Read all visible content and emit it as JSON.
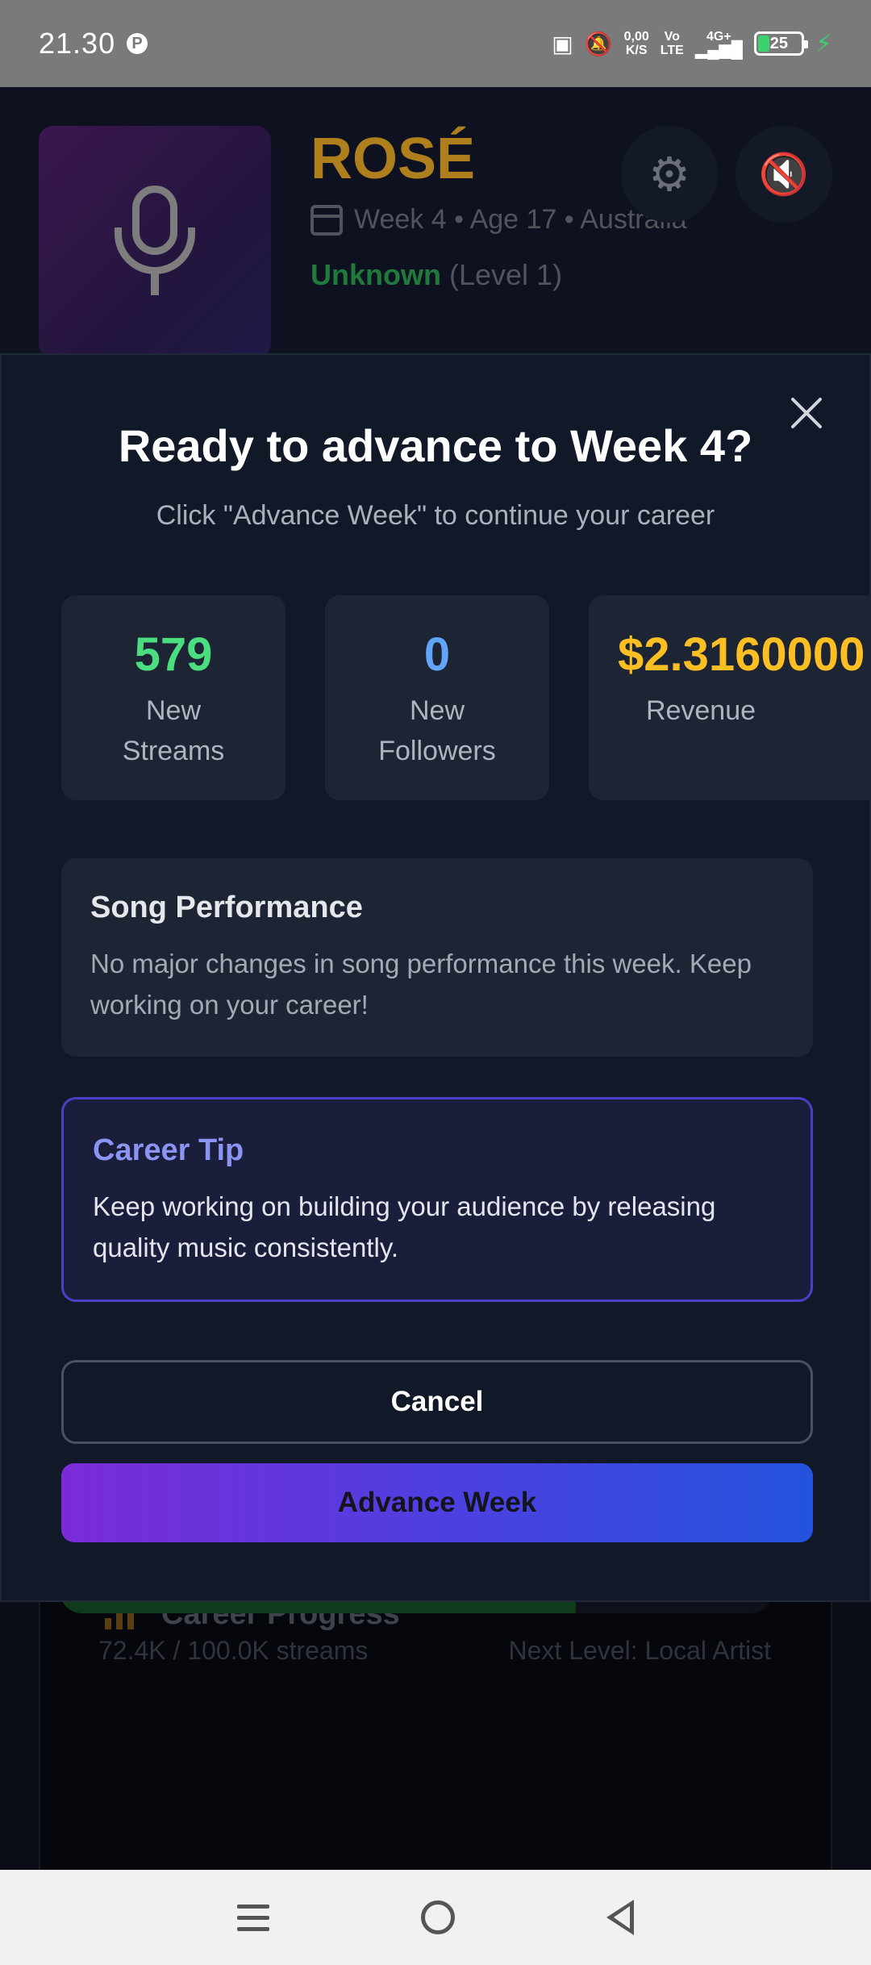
{
  "status_bar": {
    "time": "21.30",
    "p_badge": "P",
    "net_rate_top": "0,00",
    "net_rate_bottom": "K/S",
    "volte_top": "Vo",
    "volte_bottom": "LTE",
    "network": "4G+",
    "battery": "25"
  },
  "app": {
    "artist_name": "ROSÉ",
    "artist_meta": "Week 4 • Age 17 • Australia",
    "status_label": "Unknown",
    "status_level": "(Level 1)",
    "settings_icon": "gear-icon",
    "mute_icon": "mute-speaker-icon",
    "career_progress": {
      "title": "Career Progress",
      "progress": 0.724,
      "left_text": "72.4K / 100.0K streams",
      "right_text": "Next Level: Local Artist"
    }
  },
  "modal": {
    "title": "Ready to advance to Week 4?",
    "subtitle": "Click \"Advance Week\" to continue your career",
    "stats": [
      {
        "value": "579",
        "label": "New Streams",
        "color": "#4ade80"
      },
      {
        "value": "0",
        "label": "New Followers",
        "color": "#60a5fa"
      },
      {
        "value": "$2.3160000",
        "label": "Revenue",
        "color": "#fbbf24"
      }
    ],
    "performance": {
      "title": "Song Performance",
      "body": "No major changes in song performance this week. Keep working on your career!"
    },
    "tip": {
      "title": "Career Tip",
      "body": "Keep working on building your audience by releasing quality music consistently."
    },
    "cancel_label": "Cancel",
    "advance_label": "Advance Week"
  },
  "colors": {
    "accent_purple": "#7b2bd7",
    "accent_blue": "#2353de",
    "tip_border": "#4a3fc7"
  }
}
